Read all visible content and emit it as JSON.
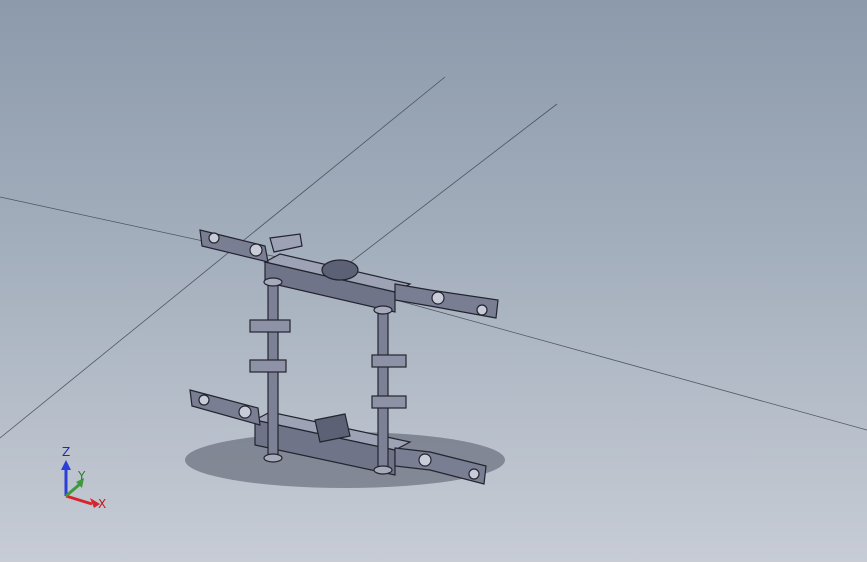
{
  "triad": {
    "x_label": "X",
    "y_label": "Y",
    "z_label": "Z"
  },
  "colors": {
    "background_top": "#8c9aab",
    "background_bottom": "#c7ccd5",
    "part_fill": "#6f7389",
    "part_edge": "#2b2d3a",
    "axis_x": "#d9232a",
    "axis_y": "#3c9a3c",
    "axis_z": "#2a3fd8"
  }
}
